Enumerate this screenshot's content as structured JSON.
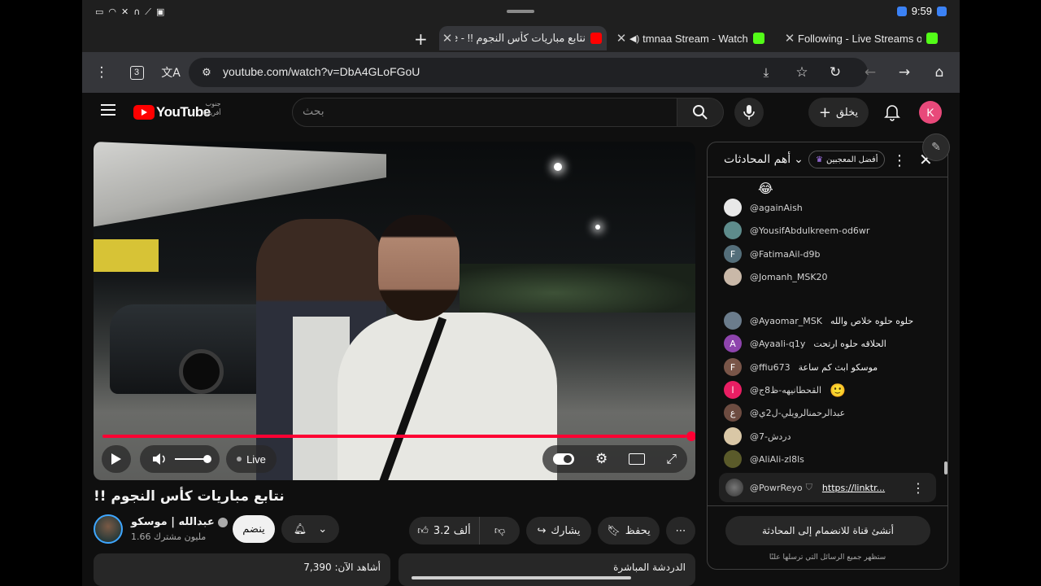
{
  "status_bar": {
    "time": "9:59",
    "left_icons": [
      "battery-icon",
      "wifi-icon",
      "headphones-icon",
      "mute-icon",
      "signal-icon",
      "cast-icon"
    ]
  },
  "tabs": [
    {
      "title": "نتابع مباريات كأس النجوم !! - ube",
      "favicon": "youtube",
      "active": true
    },
    {
      "title": "tmnaa Stream - Watch L",
      "favicon": "kick",
      "active": false,
      "audio": true
    },
    {
      "title": "Following - Live Streams on",
      "favicon": "kick",
      "active": false
    }
  ],
  "toolbar": {
    "url": "youtube.com/watch?v=DbA4GLoFGoU",
    "tab_count": "3"
  },
  "yt_header": {
    "logo_text": "YouTube",
    "region_line1": "جنوب",
    "region_line2": "أفريقيا",
    "search_placeholder": "بحث",
    "create_label": "يخلق",
    "avatar_letter": "K"
  },
  "player": {
    "live_label": "Live",
    "progress": 1.0,
    "volume": 1.0
  },
  "video": {
    "title": "نتابع مباريات كأس النجوم !!",
    "channel_name": "عبدالله | موسكو",
    "subscribers": "1.66 مليون مشترك",
    "join_label": "ينضم",
    "like_count": "3.2 ألف",
    "share_label": "يشارك",
    "save_label": "يحفظ"
  },
  "below": {
    "left_card": "أشاهد الآن: 7,390",
    "right_card": "الدردشة المباشرة"
  },
  "chat": {
    "title": "أهم المحادثات",
    "top_fans_label": "أفضل المعجبين",
    "messages": [
      {
        "author": "",
        "text": "😂",
        "avatar_letter": "",
        "avatar_color": ""
      },
      {
        "author": "@againAish",
        "text": "",
        "avatar_letter": "",
        "avatar_color": "#e8e8e8"
      },
      {
        "author": "@YousifAbdulkreem-od6wr",
        "text": "",
        "avatar_letter": "",
        "avatar_color": "#5e8c8c"
      },
      {
        "author": "@FatimaAil-d9b",
        "text": "",
        "avatar_letter": "F",
        "avatar_color": "#546e7a"
      },
      {
        "author": "@Jomanh_MSK20",
        "text": "",
        "avatar_letter": "",
        "avatar_color": "#c9b8a8"
      },
      {
        "author": "@Ayaomar_MSK",
        "text": "حلوه حلوه خلاص والله",
        "avatar_letter": "",
        "avatar_color": "#6b7c8c"
      },
      {
        "author": "@Ayaali-q1y",
        "text": "الحلاقه حلوه ارتحت",
        "avatar_letter": "A",
        "avatar_color": "#8e44ad"
      },
      {
        "author": "@ffiu673",
        "text": "موسكو ابث كم ساعة",
        "avatar_letter": "F",
        "avatar_color": "#795548"
      },
      {
        "author": "@القحطانيهه-ظ8ج",
        "text": "🙂",
        "avatar_letter": "ا",
        "avatar_color": "#e91e63"
      },
      {
        "author": "@عبدالرحمنالرويلي-ل2ي",
        "text": "",
        "avatar_letter": "ع",
        "avatar_color": "#6d4c41"
      },
      {
        "author": "@دردش-7",
        "text": "",
        "avatar_letter": "",
        "avatar_color": "#d9c7a6"
      },
      {
        "author": "@AliAli-zl8ls",
        "text": "",
        "avatar_letter": "",
        "avatar_color": "#5a5a2a"
      }
    ],
    "pinned_author": "@PowrReyo",
    "pinned_link": "https://linktr...",
    "create_channel_label": "أنشئ قناة للانضمام إلى المحادثة",
    "footer_note": "ستظهر جميع الرسائل التي ترسلها علنًا"
  }
}
